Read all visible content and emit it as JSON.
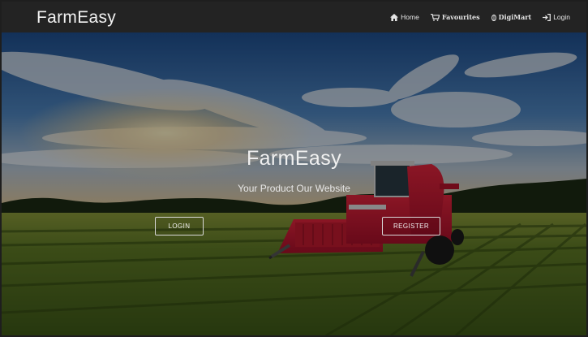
{
  "brand": "FarmEasy",
  "nav": {
    "home": "Home",
    "favourites": "Favourites",
    "digimart": "DigiMart",
    "login": "Login"
  },
  "hero": {
    "title": "FarmEasy",
    "subtitle": "Your Product Our Website",
    "login_button": "LOGIN",
    "register_button": "REGISTER"
  },
  "icons": [
    "home-icon",
    "cart-icon",
    "seed-icon",
    "sign-in-icon"
  ],
  "colors": {
    "navbar": "#232323",
    "nav_text": "#e6e6e6",
    "harvester": "#c0152c",
    "field": "#4a6a1e"
  }
}
